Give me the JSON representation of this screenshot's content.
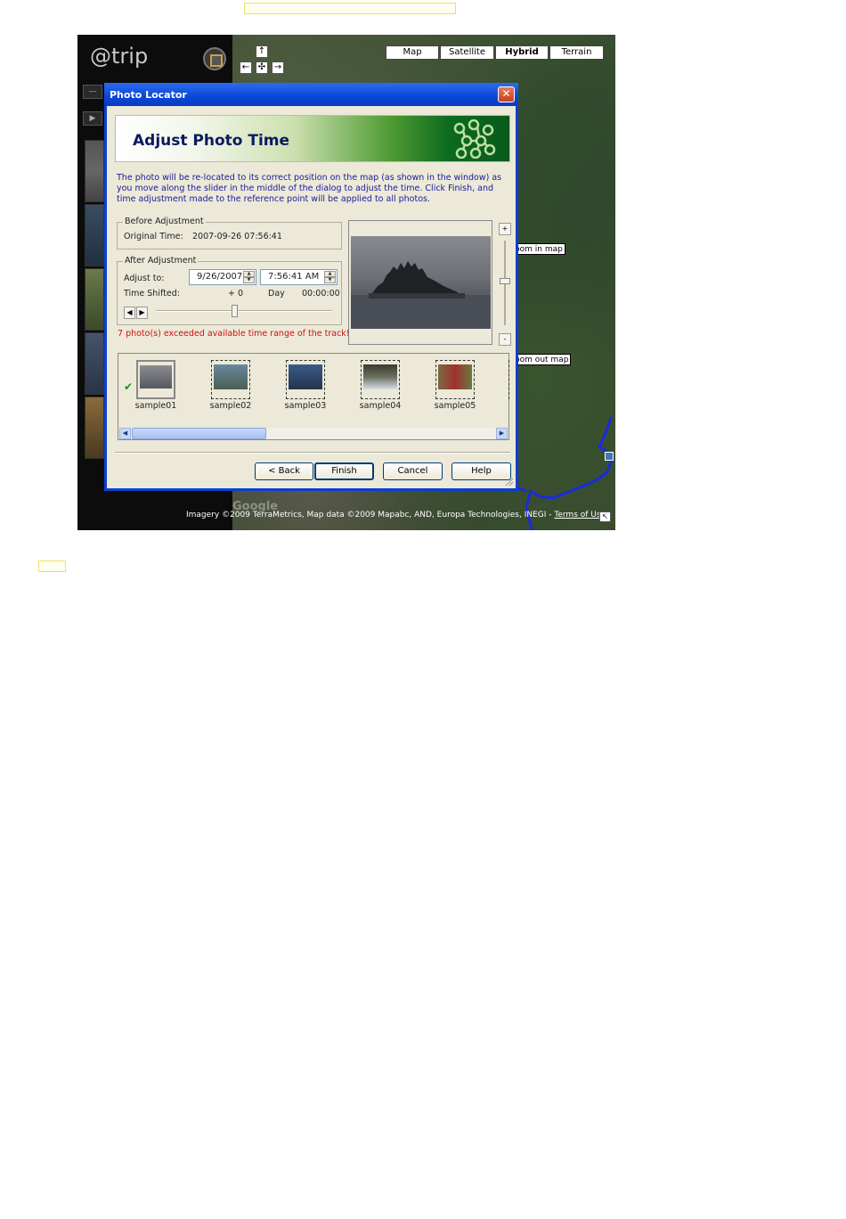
{
  "map": {
    "types": [
      "Map",
      "Satellite",
      "Hybrid",
      "Terrain"
    ],
    "selected_type": "Hybrid",
    "nav": {
      "up": "↑",
      "left": "←",
      "center": "✣",
      "right": "→"
    },
    "zoom_in_tip": "Zoom in map",
    "zoom_out_tip": "Zoom out map",
    "attribution": "Imagery ©2009 TerraMetrics, Map data ©2009 Mapabc, AND, Europa Technologies, INEGI - ",
    "terms": "Terms of Use",
    "google": "Google"
  },
  "app": {
    "logo": "@trip"
  },
  "dialog": {
    "title": "Photo Locator",
    "close": "✕",
    "banner_title": "Adjust Photo Time",
    "description": "The photo will be re-located to its correct position on the map (as shown in the window) as you move along the slider in the middle of the dialog to adjust the time. Click Finish, and time adjustment made to the reference point will be applied to all photos.",
    "before": {
      "legend": "Before Adjustment",
      "label": "Original Time:",
      "value": "2007-09-26 07:56:41"
    },
    "after": {
      "legend": "After Adjustment",
      "adjust_label": "Adjust to:",
      "date": "9/26/2007",
      "time": "7:56:41 AM",
      "shift_label": "Time Shifted:",
      "shift_days": "+ 0",
      "day_label": "Day",
      "shift_time": "00:00:00"
    },
    "warning": "7 photo(s) exceeded available time range of the track!",
    "preview_zoom_in": "+",
    "preview_zoom_out": "-",
    "thumbnails": [
      "sample01",
      "sample02",
      "sample03",
      "sample04",
      "sample05"
    ],
    "selected_thumbnail": "sample01",
    "buttons": {
      "back": "< Back",
      "finish": "Finish",
      "cancel": "Cancel",
      "help": "Help"
    }
  }
}
